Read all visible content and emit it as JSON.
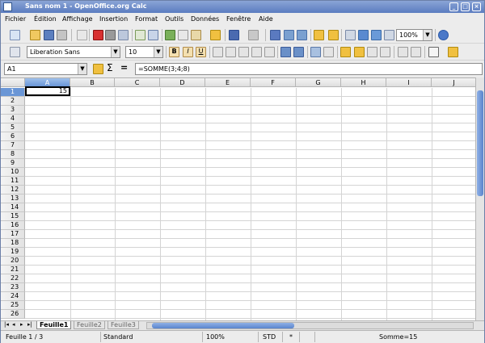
{
  "window": {
    "title": "Sans nom 1 - OpenOffice.org Calc"
  },
  "menu": [
    "Fichier",
    "Édition",
    "Affichage",
    "Insertion",
    "Format",
    "Outils",
    "Données",
    "Fenêtre",
    "Aide"
  ],
  "toolbar": {
    "zoom": "100%"
  },
  "formatting": {
    "font_name": "Liberation Sans",
    "font_size": "10"
  },
  "formula_bar": {
    "name_box": "A1",
    "formula": "=SOMME(3;4;8)"
  },
  "sheet": {
    "columns": [
      "A",
      "B",
      "C",
      "D",
      "E",
      "F",
      "G",
      "H",
      "I",
      "J"
    ],
    "rows": [
      "1",
      "2",
      "3",
      "4",
      "5",
      "6",
      "7",
      "8",
      "9",
      "10",
      "11",
      "12",
      "13",
      "14",
      "15",
      "16",
      "17",
      "18",
      "19",
      "20",
      "21",
      "22",
      "23",
      "24",
      "25",
      "26"
    ],
    "active_cell": "A1",
    "a1_value": "15"
  },
  "tabs": [
    "Feuille1",
    "Feuille2",
    "Feuille3"
  ],
  "status": {
    "sheet": "Feuille 1 / 3",
    "style": "Standard",
    "zoom": "100%",
    "mode": "STD",
    "modified": "*",
    "sum": "Somme=15"
  }
}
